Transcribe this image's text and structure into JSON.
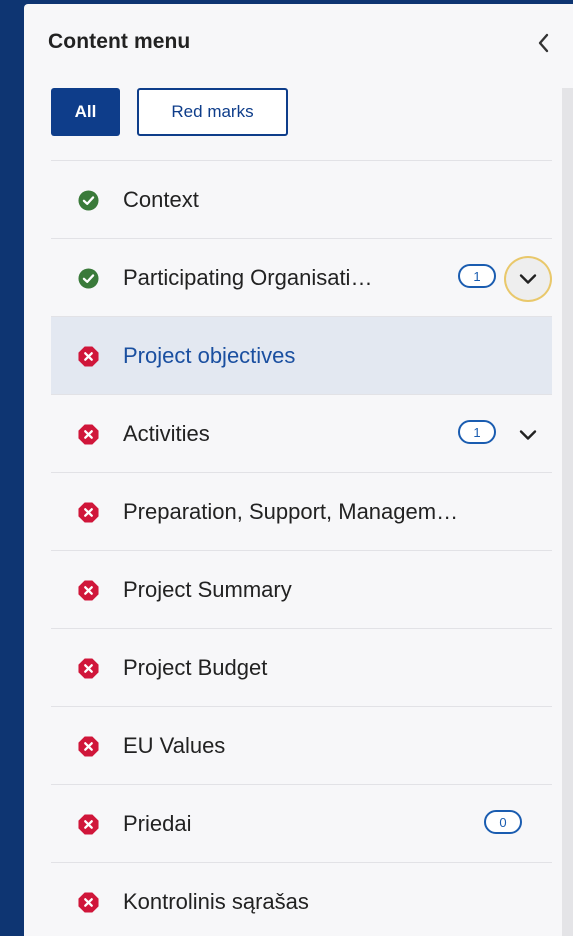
{
  "panel": {
    "title": "Content menu"
  },
  "filters": {
    "all_label": "All",
    "red_marks_label": "Red marks"
  },
  "colors": {
    "background": "#0e3572",
    "accent": "#0e3d8a",
    "done_green": "#3a7a3a",
    "error_red": "#d0163a",
    "badge_blue": "#1a5cb0",
    "active_row": "#e3e8f1"
  },
  "items": [
    {
      "label": "Context",
      "status": "done",
      "badge": null,
      "expandable": false
    },
    {
      "label": "Participating Organisati…",
      "status": "done",
      "badge": "1",
      "expandable": true,
      "focused": true
    },
    {
      "label": "Project objectives",
      "status": "error",
      "badge": null,
      "expandable": false,
      "active": true
    },
    {
      "label": "Activities",
      "status": "error",
      "badge": "1",
      "expandable": true
    },
    {
      "label": "Preparation, Support, Managem…",
      "status": "error",
      "badge": null,
      "expandable": false
    },
    {
      "label": "Project Summary",
      "status": "error",
      "badge": null,
      "expandable": false
    },
    {
      "label": "Project Budget",
      "status": "error",
      "badge": null,
      "expandable": false
    },
    {
      "label": "EU Values",
      "status": "error",
      "badge": null,
      "expandable": false
    },
    {
      "label": "Priedai",
      "status": "error",
      "badge": "0",
      "expandable": false
    },
    {
      "label": "Kontrolinis sąrašas",
      "status": "error",
      "badge": null,
      "expandable": false
    }
  ]
}
